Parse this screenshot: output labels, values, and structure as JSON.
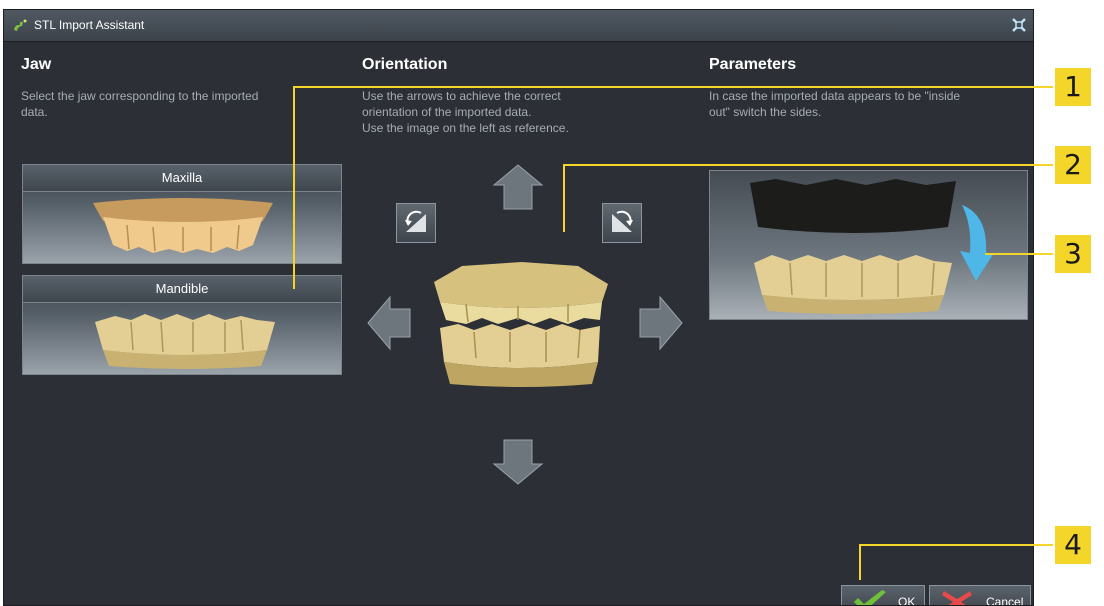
{
  "window": {
    "title": "STL Import Assistant"
  },
  "jaw": {
    "heading": "Jaw",
    "desc_line1": "Select the jaw corresponding to the imported",
    "desc_line2": "data.",
    "options": [
      {
        "label": "Maxilla"
      },
      {
        "label": "Mandible"
      }
    ]
  },
  "orientation": {
    "heading": "Orientation",
    "desc_line1": "Use the arrows to achieve the correct",
    "desc_line2": "orientation of the imported data.",
    "desc_line3": "Use the image on the left as reference."
  },
  "parameters": {
    "heading": "Parameters",
    "desc_line1": "In case the imported data appears to be \"inside",
    "desc_line2": "out\" switch the sides."
  },
  "buttons": {
    "ok": "OK",
    "cancel": "Cancel"
  },
  "callouts": [
    "1",
    "2",
    "3",
    "4"
  ],
  "colors": {
    "callout": "#f4d52a",
    "teeth": "#e3cf94",
    "maxilla_teeth": "#f0c98c",
    "flip_arrow": "#4fb6e8",
    "ok_check": "#6fbf3a",
    "cancel_x": "#e64a4a"
  },
  "icons": [
    "stl-app-icon",
    "restore-icon",
    "arrow-up-icon",
    "arrow-down-icon",
    "arrow-left-icon",
    "arrow-right-icon",
    "rotate-left-icon",
    "rotate-right-icon",
    "flip-arrow-icon",
    "checkmark-icon",
    "cancel-x-icon"
  ]
}
